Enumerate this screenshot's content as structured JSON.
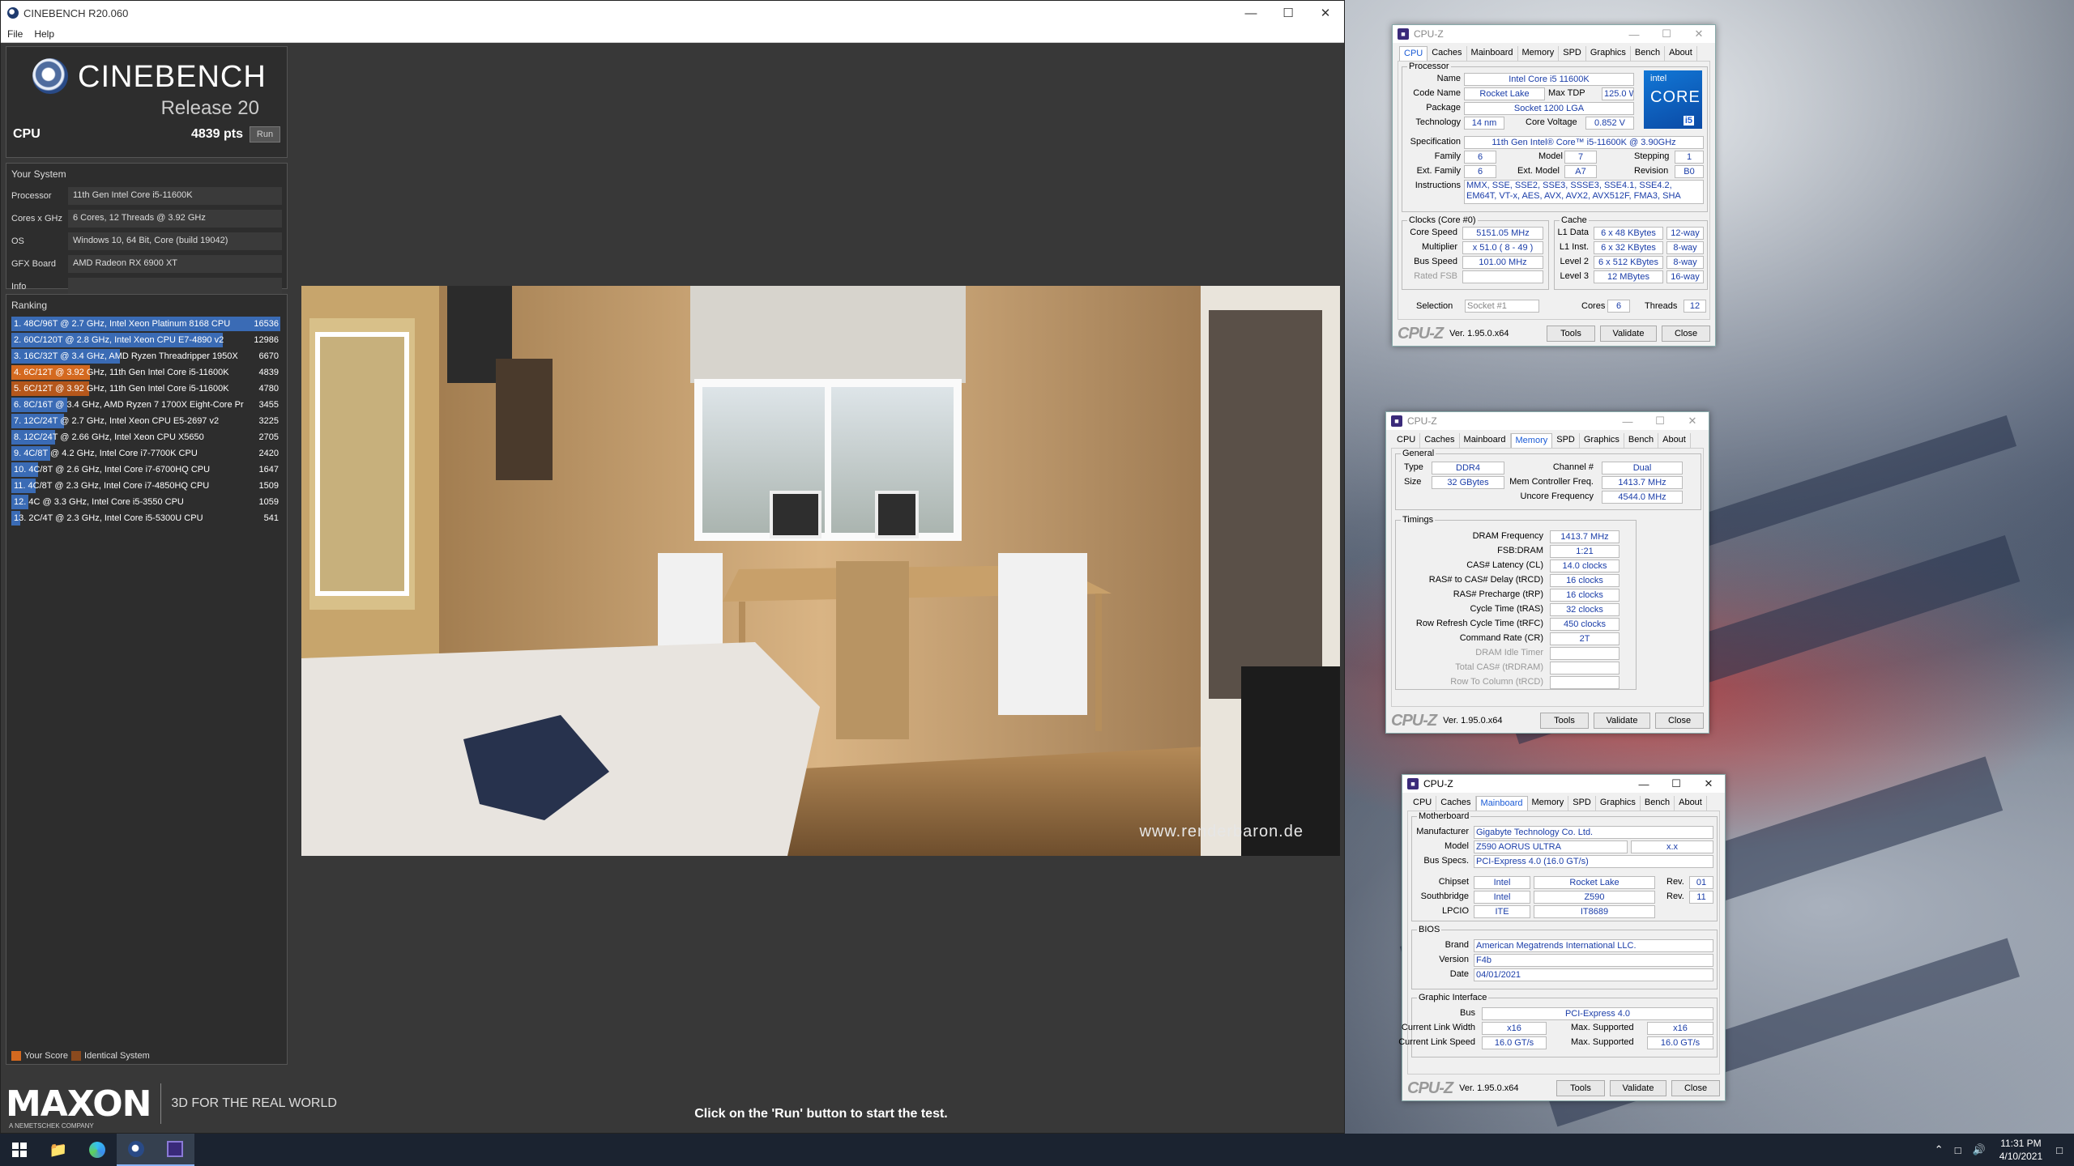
{
  "cinebench": {
    "window_title": "CINEBENCH R20.060",
    "menu": [
      "File",
      "Help"
    ],
    "logo_title": "CINEBENCH",
    "logo_release": "Release 20",
    "cpu_label": "CPU",
    "cpu_score": "4839 pts",
    "run_label": "Run",
    "your_system_title": "Your System",
    "system": [
      {
        "key": "Processor",
        "value": "11th Gen Intel Core i5-11600K"
      },
      {
        "key": "Cores x GHz",
        "value": "6 Cores, 12 Threads @ 3.92 GHz"
      },
      {
        "key": "OS",
        "value": "Windows 10, 64 Bit, Core (build 19042)"
      },
      {
        "key": "GFX Board",
        "value": "AMD Radeon RX 6900 XT"
      },
      {
        "key": "Info",
        "value": ""
      }
    ],
    "ranking_title": "Ranking",
    "ranking": [
      {
        "text": "1. 48C/96T @ 2.7 GHz, Intel Xeon Platinum 8168 CPU",
        "score": 16536,
        "color": "#3a6bb5",
        "fraction": 1.0
      },
      {
        "text": "2. 60C/120T @ 2.8 GHz, Intel Xeon CPU E7-4890 v2",
        "score": 12986,
        "color": "#3a6bb5",
        "fraction": 0.785
      },
      {
        "text": "3. 16C/32T @ 3.4 GHz, AMD Ryzen Threadripper 1950X",
        "score": 6670,
        "color": "#3a6bb5",
        "fraction": 0.403
      },
      {
        "text": "4. 6C/12T @ 3.92 GHz, 11th Gen Intel Core i5-11600K",
        "score": 4839,
        "color": "#d4691f",
        "fraction": 0.293
      },
      {
        "text": "5. 6C/12T @ 3.92 GHz, 11th Gen Intel Core i5-11600K",
        "score": 4780,
        "color": "#b5571b",
        "fraction": 0.289
      },
      {
        "text": "6. 8C/16T @ 3.4 GHz, AMD Ryzen 7 1700X Eight-Core Pr",
        "score": 3455,
        "color": "#3a6bb5",
        "fraction": 0.209
      },
      {
        "text": "7. 12C/24T @ 2.7 GHz, Intel Xeon CPU E5-2697 v2",
        "score": 3225,
        "color": "#3a6bb5",
        "fraction": 0.195
      },
      {
        "text": "8. 12C/24T @ 2.66 GHz, Intel Xeon CPU X5650",
        "score": 2705,
        "color": "#3a6bb5",
        "fraction": 0.164
      },
      {
        "text": "9. 4C/8T @ 4.2 GHz, Intel Core i7-7700K CPU",
        "score": 2420,
        "color": "#3a6bb5",
        "fraction": 0.146
      },
      {
        "text": "10. 4C/8T @ 2.6 GHz, Intel Core i7-6700HQ CPU",
        "score": 1647,
        "color": "#3a6bb5",
        "fraction": 0.1
      },
      {
        "text": "11. 4C/8T @ 2.3 GHz, Intel Core i7-4850HQ CPU",
        "score": 1509,
        "color": "#3a6bb5",
        "fraction": 0.091
      },
      {
        "text": "12. 4C @ 3.3 GHz, Intel Core i5-3550 CPU",
        "score": 1059,
        "color": "#3a6bb5",
        "fraction": 0.064
      },
      {
        "text": "13. 2C/4T @ 2.3 GHz, Intel Core i5-5300U CPU",
        "score": 541,
        "color": "#3a6bb5",
        "fraction": 0.033
      }
    ],
    "legend": [
      {
        "label": "Your Score",
        "color": "#d4691f"
      },
      {
        "label": "Identical System",
        "color": "#8a4a1e"
      }
    ],
    "maxon_logo": "MAXON",
    "maxon_sub": "A NEMETSCHEK COMPANY",
    "maxon_tagline": "3D FOR THE REAL WORLD",
    "render_watermark": "www.renderbaron.de",
    "status_text": "Click on the 'Run' button to start the test."
  },
  "cpuz_common": {
    "title": "CPU-Z",
    "tabs": [
      "CPU",
      "Caches",
      "Mainboard",
      "Memory",
      "SPD",
      "Graphics",
      "Bench",
      "About"
    ],
    "brand": "CPU-Z",
    "version": "Ver. 1.95.0.x64",
    "tools": "Tools",
    "validate": "Validate",
    "close": "Close"
  },
  "cpuz_cpu": {
    "processor_group": "Processor",
    "name_label": "Name",
    "name": "Intel Core i5 11600K",
    "codename_label": "Code Name",
    "codename": "Rocket Lake",
    "maxtdp_label": "Max TDP",
    "maxtdp": "125.0 W",
    "package_label": "Package",
    "package": "Socket 1200 LGA",
    "technology_label": "Technology",
    "technology": "14 nm",
    "corevoltage_label": "Core Voltage",
    "corevoltage": "0.852 V",
    "spec_label": "Specification",
    "spec": "11th Gen Intel® Core™ i5-11600K @ 3.90GHz",
    "family_label": "Family",
    "family": "6",
    "model_label": "Model",
    "model": "7",
    "stepping_label": "Stepping",
    "stepping": "1",
    "extfamily_label": "Ext. Family",
    "extfamily": "6",
    "extmodel_label": "Ext. Model",
    "extmodel": "A7",
    "revision_label": "Revision",
    "revision": "B0",
    "instructions_label": "Instructions",
    "instructions": "MMX, SSE, SSE2, SSE3, SSSE3, SSE4.1, SSE4.2, EM64T, VT-x, AES, AVX, AVX2, AVX512F, FMA3, SHA",
    "clocks_group": "Clocks (Core #0)",
    "corespeed_label": "Core Speed",
    "corespeed": "5151.05 MHz",
    "multiplier_label": "Multiplier",
    "multiplier": "x 51.0 ( 8 - 49 )",
    "busspeed_label": "Bus Speed",
    "busspeed": "101.00 MHz",
    "ratedfsb_label": "Rated FSB",
    "ratedfsb": "",
    "cache_group": "Cache",
    "l1data_label": "L1 Data",
    "l1data": "6 x 48 KBytes",
    "l1data_way": "12-way",
    "l1inst_label": "L1 Inst.",
    "l1inst": "6 x 32 KBytes",
    "l1inst_way": "8-way",
    "l2_label": "Level 2",
    "l2": "6 x 512 KBytes",
    "l2_way": "8-way",
    "l3_label": "Level 3",
    "l3": "12 MBytes",
    "l3_way": "16-way",
    "selection_label": "Selection",
    "selection": "Socket #1",
    "cores_label": "Cores",
    "cores": "6",
    "threads_label": "Threads",
    "threads": "12",
    "intel_line1": "intel",
    "intel_line2": "CORE",
    "intel_line3": "i5"
  },
  "cpuz_mem": {
    "general_group": "General",
    "type_label": "Type",
    "type": "DDR4",
    "channel_label": "Channel #",
    "channel": "Dual",
    "size_label": "Size",
    "size": "32 GBytes",
    "memctrl_label": "Mem Controller Freq.",
    "memctrl": "1413.7 MHz",
    "uncore_label": "Uncore Frequency",
    "uncore": "4544.0 MHz",
    "timings_group": "Timings",
    "timings": [
      {
        "label": "DRAM Frequency",
        "value": "1413.7 MHz",
        "dim": false
      },
      {
        "label": "FSB:DRAM",
        "value": "1:21",
        "dim": false
      },
      {
        "label": "CAS# Latency (CL)",
        "value": "14.0 clocks",
        "dim": false
      },
      {
        "label": "RAS# to CAS# Delay (tRCD)",
        "value": "16 clocks",
        "dim": false
      },
      {
        "label": "RAS# Precharge (tRP)",
        "value": "16 clocks",
        "dim": false
      },
      {
        "label": "Cycle Time (tRAS)",
        "value": "32 clocks",
        "dim": false
      },
      {
        "label": "Row Refresh Cycle Time (tRFC)",
        "value": "450 clocks",
        "dim": false
      },
      {
        "label": "Command Rate (CR)",
        "value": "2T",
        "dim": false
      },
      {
        "label": "DRAM Idle Timer",
        "value": "",
        "dim": true
      },
      {
        "label": "Total CAS# (tRDRAM)",
        "value": "",
        "dim": true
      },
      {
        "label": "Row To Column (tRCD)",
        "value": "",
        "dim": true
      }
    ]
  },
  "cpuz_mb": {
    "motherboard_group": "Motherboard",
    "manufacturer_label": "Manufacturer",
    "manufacturer": "Gigabyte Technology Co. Ltd.",
    "model_label": "Model",
    "model": "Z590 AORUS ULTRA",
    "model_rev": "x.x",
    "busspecs_label": "Bus Specs.",
    "busspecs": "PCI-Express 4.0 (16.0 GT/s)",
    "chipset_label": "Chipset",
    "chipset_vendor": "Intel",
    "chipset_model": "Rocket Lake",
    "chipset_rev_label": "Rev.",
    "chipset_rev": "01",
    "southbridge_label": "Southbridge",
    "southbridge_vendor": "Intel",
    "southbridge_model": "Z590",
    "southbridge_rev_label": "Rev.",
    "southbridge_rev": "11",
    "lpcio_label": "LPCIO",
    "lpcio_vendor": "ITE",
    "lpcio_model": "IT8689",
    "bios_group": "BIOS",
    "brand_label": "Brand",
    "brand": "American Megatrends International LLC.",
    "version_label": "Version",
    "version": "F4b",
    "date_label": "Date",
    "date": "04/01/2021",
    "graphic_group": "Graphic Interface",
    "bus_label": "Bus",
    "bus": "PCI-Express 4.0",
    "linkwidth_label": "Current Link Width",
    "linkwidth": "x16",
    "maxwidth_label": "Max. Supported",
    "maxwidth": "x16",
    "linkspeed_label": "Current Link Speed",
    "linkspeed": "16.0 GT/s",
    "maxspeed_label": "Max. Supported",
    "maxspeed": "16.0 GT/s"
  },
  "taskbar": {
    "time": "11:31 PM",
    "date": "4/10/2021"
  }
}
